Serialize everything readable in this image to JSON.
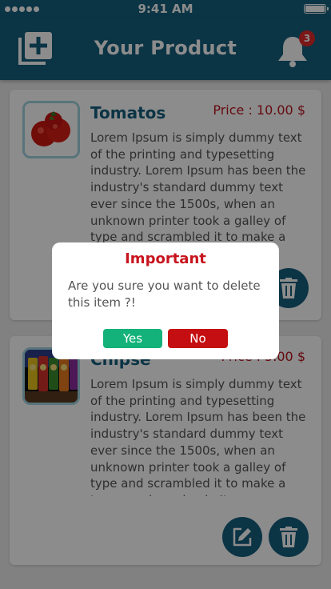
{
  "status_bar": {
    "time": "9:41 AM",
    "signal_icon": "signal-dots-icon",
    "battery_icon": "battery-full-icon"
  },
  "header": {
    "title": "Your Product",
    "add_icon": "add-box-icon",
    "bell_icon": "bell-icon",
    "notification_count": "3"
  },
  "products": [
    {
      "name": "Tomatos",
      "price": "Price : 10.00 $",
      "image": "tomato-photo",
      "description": "Lorem Ipsum is simply dummy text of the printing and typesetting industry. Lorem Ipsum has been the industry's standard dummy text ever since the 1500s, when an unknown printer took a galley of type and scrambled it to make a type specimen book. It",
      "actions": [
        "delete-icon"
      ]
    },
    {
      "name": "Chipse",
      "price": "Price : 5.00 $",
      "image": "chips-photo",
      "description": "Lorem Ipsum is simply dummy text of the printing and typesetting industry. Lorem Ipsum has been the industry's standard dummy text ever since the 1500s, when an unknown printer took a galley of type and scrambled it to make a type specimen book. It",
      "actions": [
        "edit-icon",
        "delete-icon"
      ]
    }
  ],
  "dialog": {
    "title": "Important",
    "message": "Are you sure you want to delete this item ?!",
    "yes_label": "Yes",
    "no_label": "No"
  },
  "colors": {
    "primary": "#14607f",
    "price": "#b8141d",
    "yes": "#13b27a",
    "no": "#c50e11",
    "badge": "#e22a2a"
  }
}
